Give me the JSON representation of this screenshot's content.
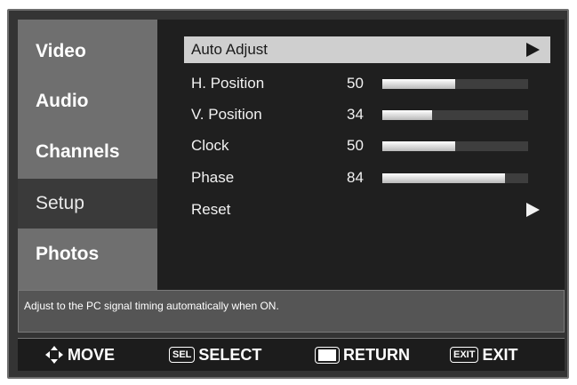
{
  "sidebar": {
    "items": [
      {
        "label": "Video"
      },
      {
        "label": "Audio"
      },
      {
        "label": "Channels"
      },
      {
        "label": "Setup",
        "active": true
      },
      {
        "label": "Photos"
      }
    ]
  },
  "settings": {
    "rows": [
      {
        "label": "Auto Adjust",
        "arrow": "▶",
        "selected": true
      },
      {
        "label": "H. Position",
        "value": "50",
        "level": 0.5
      },
      {
        "label": "V. Position",
        "value": "34",
        "level": 0.34
      },
      {
        "label": "Clock",
        "value": "50",
        "level": 0.5
      },
      {
        "label": "Phase",
        "value": "84",
        "level": 0.84
      },
      {
        "label": "Reset",
        "arrow": "▶"
      }
    ]
  },
  "help": {
    "text": "Adjust to the PC signal timing automatically when ON."
  },
  "footer": {
    "move": "MOVE",
    "sel_key": "SEL",
    "select": "SELECT",
    "return": "RETURN",
    "exit_key": "EXIT",
    "exit": "EXIT"
  },
  "colors": {
    "frame": "#343434",
    "sidebar": "#6f6f6f",
    "panel": "#1f1f1f",
    "selected_row": "#cfcfcf"
  }
}
